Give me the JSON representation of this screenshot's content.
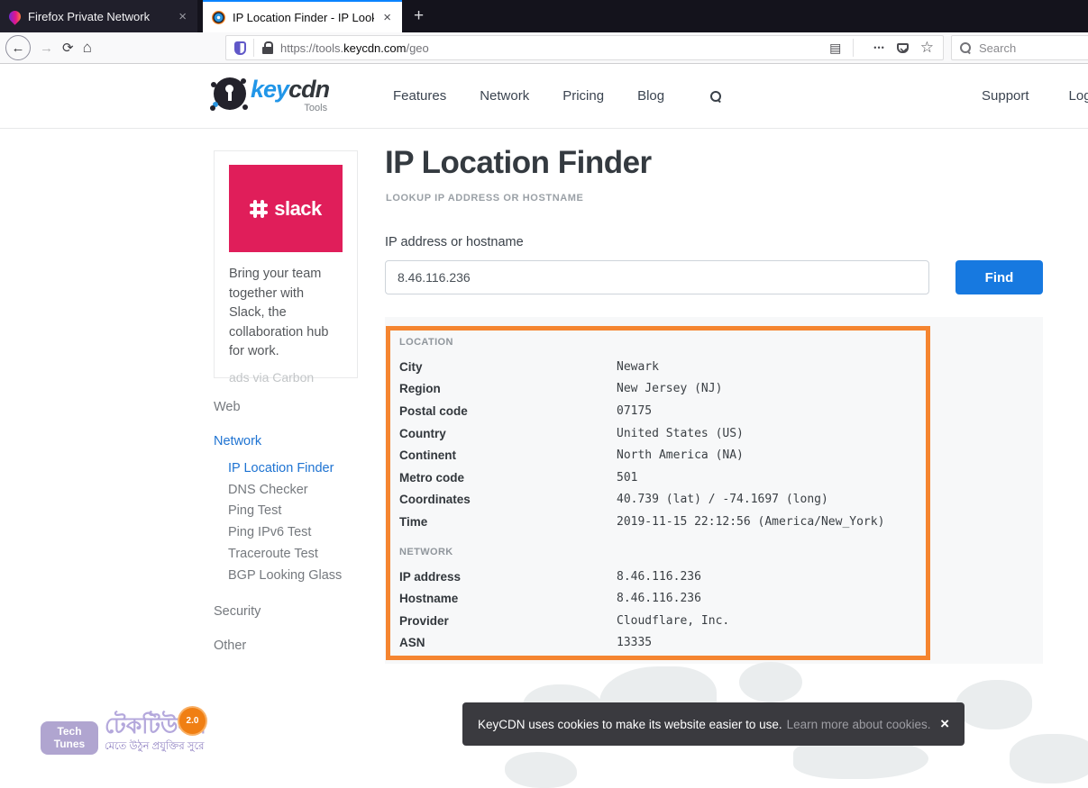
{
  "browser": {
    "tab1": {
      "title": "Firefox Private Network"
    },
    "tab2": {
      "title": "IP Location Finder - IP Lookup"
    },
    "close_glyph": "×",
    "new_tab_glyph": "+",
    "back_glyph": "←",
    "forward_glyph": "→",
    "refresh_glyph": "⟳",
    "home_glyph": "⌂",
    "reader_glyph": "▤",
    "more_glyph": "•••",
    "star_glyph": "☆",
    "url_prefix": "https://tools.",
    "url_domain": "keycdn.com",
    "url_path": "/geo",
    "search_placeholder": "Search"
  },
  "header": {
    "logo_key": "key",
    "logo_cdn": "cdn",
    "logo_sub": "Tools",
    "nav_features": "Features",
    "nav_network": "Network",
    "nav_pricing": "Pricing",
    "nav_blog": "Blog",
    "support": "Support",
    "login": "Login"
  },
  "sidebar": {
    "ad": {
      "brand": "slack",
      "copy": "Bring your team together with Slack, the collaboration hub for work.",
      "attribution": "ads via Carbon"
    },
    "web": "Web",
    "network": "Network",
    "network_items": [
      "IP Location Finder",
      "DNS Checker",
      "Ping Test",
      "Ping IPv6 Test",
      "Traceroute Test",
      "BGP Looking Glass"
    ],
    "active_item": "IP Location Finder",
    "security": "Security",
    "other": "Other"
  },
  "main": {
    "title": "IP Location Finder",
    "subtitle": "LOOKUP IP ADDRESS OR HOSTNAME",
    "input_label": "IP address or hostname",
    "input_value": "8.46.116.236",
    "find": "Find",
    "location_heading": "LOCATION",
    "location_rows": [
      {
        "label": "City",
        "value": "Newark"
      },
      {
        "label": "Region",
        "value": "New Jersey (NJ)"
      },
      {
        "label": "Postal code",
        "value": "07175"
      },
      {
        "label": "Country",
        "value": "United States (US)"
      },
      {
        "label": "Continent",
        "value": "North America (NA)"
      },
      {
        "label": "Metro code",
        "value": "501"
      },
      {
        "label": "Coordinates",
        "value": "40.739 (lat) / -74.1697 (long)"
      },
      {
        "label": "Time",
        "value": "2019-11-15 22:12:56 (America/New_York)"
      }
    ],
    "network_heading": "NETWORK",
    "network_rows": [
      {
        "label": "IP address",
        "value": "8.46.116.236"
      },
      {
        "label": "Hostname",
        "value": "8.46.116.236"
      },
      {
        "label": "Provider",
        "value": "Cloudflare, Inc."
      },
      {
        "label": "ASN",
        "value": "13335"
      }
    ]
  },
  "cookie": {
    "message": "KeyCDN uses cookies to make its website easier to use.",
    "link": "Learn more about cookies.",
    "close_glyph": "×"
  },
  "watermark": {
    "box_line1": "Tech",
    "box_line2": "Tunes",
    "bangla_title": "টেকটিউনস",
    "badge": "2.0",
    "bangla_tagline": "মেতে উঠুন প্রযুক্তির সুরে"
  },
  "colors": {
    "find_button_blue": "#1779e0",
    "link_blue": "#1e73d2",
    "annotation_orange": "#f58530",
    "slack_pink": "#e01e5a",
    "logo_blue": "#2196e8"
  }
}
